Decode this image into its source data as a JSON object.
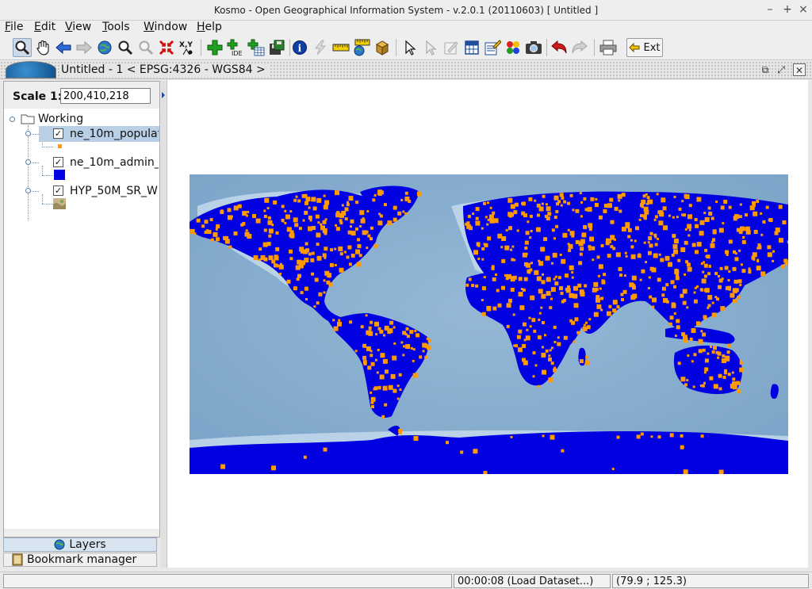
{
  "window": {
    "title": "Kosmo - Open Geographical Information System - v.2.0.1 (20110603)  [ Untitled ]",
    "controls": [
      "–",
      "+",
      "×"
    ]
  },
  "menu": [
    {
      "label": "File",
      "mnemonic": "F"
    },
    {
      "label": "Edit",
      "mnemonic": "E"
    },
    {
      "label": "View",
      "mnemonic": "V"
    },
    {
      "label": "Tools",
      "mnemonic": "T"
    },
    {
      "label": "Window",
      "mnemonic": "W"
    },
    {
      "label": "Help",
      "mnemonic": "H"
    }
  ],
  "toolbar": {
    "tools": [
      "zoom-tool-icon",
      "pan-hand-icon",
      "back-arrow-icon",
      "forward-arrow-icon",
      "zoom-full-extent-icon",
      "zoom-in-icon",
      "zoom-out-icon",
      "zoom-to-selected-icon",
      "coordinates-xy-icon",
      "add-layer-icon",
      "add-ide-layer-icon",
      "add-table-layer-icon",
      "save-layer-icon",
      "info-icon",
      "lightning-icon",
      "measure-ruler-icon",
      "measure-area-icon",
      "box-icon",
      "select-arrow-icon",
      "select-edit-icon",
      "edit-geometry-icon",
      "table-grid-icon",
      "feature-edit-icon",
      "color-palette-icon",
      "camera-icon",
      "undo-icon",
      "redo-icon",
      "print-icon"
    ],
    "ext_label": "Ext"
  },
  "document": {
    "title": "Untitled - 1 < EPSG:4326 - WGS84 >"
  },
  "scale": {
    "label": "Scale 1:",
    "value": "200,410,218"
  },
  "layers": {
    "group_label": "Working",
    "items": [
      {
        "name": "ne_10m_populat",
        "checked": true,
        "selected": true,
        "swatch_color": "#ff9a00"
      },
      {
        "name": "ne_10m_admin_(",
        "checked": true,
        "selected": false,
        "swatch_color": "#0000e0"
      },
      {
        "name": "HYP_50M_SR_W",
        "checked": true,
        "selected": false,
        "swatch_color": "#b8a07c"
      }
    ]
  },
  "panel_tabs": {
    "layers": "Layers",
    "bookmarks": "Bookmark manager"
  },
  "map": {
    "ocean_color": "#8ab0d0",
    "land_color": "#0000e0",
    "points_color": "#ff9a00"
  },
  "status": {
    "left": "",
    "task": "00:00:08 (Load Dataset...)",
    "coords": "(79.9 ; 125.3)"
  }
}
